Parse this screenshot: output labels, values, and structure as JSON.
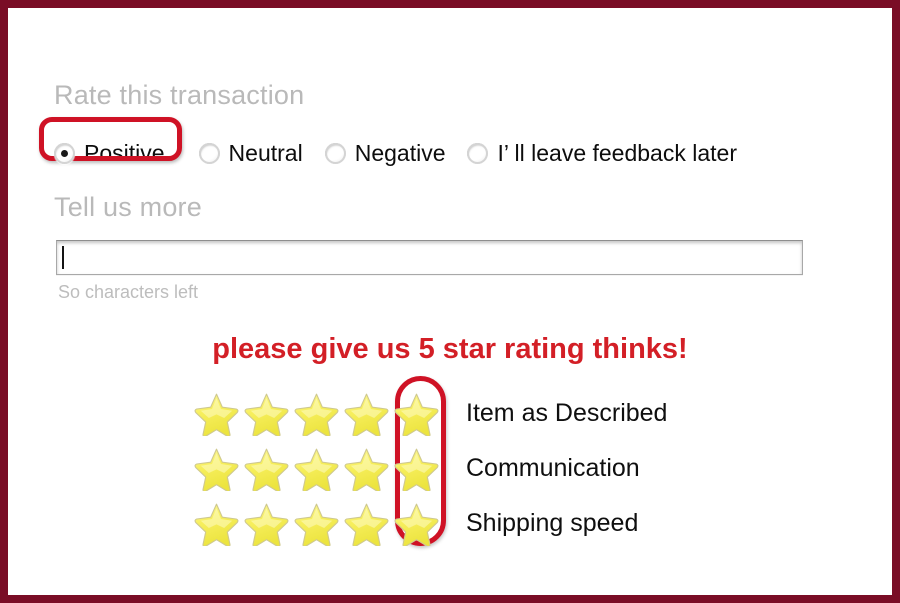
{
  "window": {
    "border_color": "#7a0d26",
    "background": "#ffffff"
  },
  "rate_section": {
    "heading": "Rate this transaction",
    "options": [
      {
        "label": "Positive",
        "selected": true,
        "highlighted": true
      },
      {
        "label": "Neutral",
        "selected": false,
        "highlighted": false
      },
      {
        "label": "Negative",
        "selected": false,
        "highlighted": false
      },
      {
        "label": "I’  ll leave feedback later",
        "selected": false,
        "highlighted": false
      }
    ]
  },
  "tell_section": {
    "heading": "Tell us more",
    "input_value": "",
    "input_placeholder": "",
    "chars_left": "So characters left"
  },
  "promo": {
    "text": "please give us 5 star rating thinks!",
    "color": "#d31f26"
  },
  "ratings": {
    "star_count": 5,
    "highlight_color": "#cf1225",
    "star_color": "#f4ec52",
    "rows": [
      {
        "label": "Item as Described",
        "value": 5
      },
      {
        "label": "Communication",
        "value": 5
      },
      {
        "label": "Shipping speed",
        "value": 5
      }
    ]
  }
}
